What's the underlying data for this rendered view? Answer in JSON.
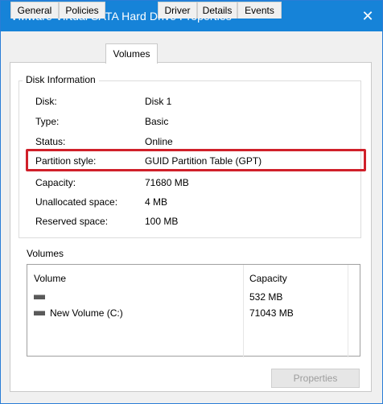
{
  "window": {
    "title": "VMware Virtual SATA Hard Drive Properties",
    "close_glyph": "✕"
  },
  "tabs": [
    {
      "label": "General",
      "active": false
    },
    {
      "label": "Policies",
      "active": false
    },
    {
      "label": "Volumes",
      "active": true
    },
    {
      "label": "Driver",
      "active": false
    },
    {
      "label": "Details",
      "active": false
    },
    {
      "label": "Events",
      "active": false
    }
  ],
  "disk_info": {
    "group_title": "Disk Information",
    "rows": [
      {
        "label": "Disk:",
        "value": "Disk 1"
      },
      {
        "label": "Type:",
        "value": "Basic"
      },
      {
        "label": "Status:",
        "value": "Online"
      },
      {
        "label": "Partition style:",
        "value": "GUID Partition Table (GPT)"
      },
      {
        "label": "Capacity:",
        "value": "71680 MB"
      },
      {
        "label": "Unallocated space:",
        "value": "4 MB"
      },
      {
        "label": "Reserved space:",
        "value": "100 MB"
      }
    ],
    "highlight_color": "#d0202a"
  },
  "volumes": {
    "label": "Volumes",
    "columns": {
      "volume": "Volume",
      "capacity": "Capacity"
    },
    "rows": [
      {
        "name": "",
        "capacity": "532 MB",
        "icon": "drive-icon"
      },
      {
        "name": "New Volume (C:)",
        "capacity": "71043 MB",
        "icon": "drive-icon"
      }
    ],
    "properties_button": "Properties"
  },
  "colors": {
    "titlebar": "#1683d8",
    "accent_border": "#2a7dd6"
  }
}
